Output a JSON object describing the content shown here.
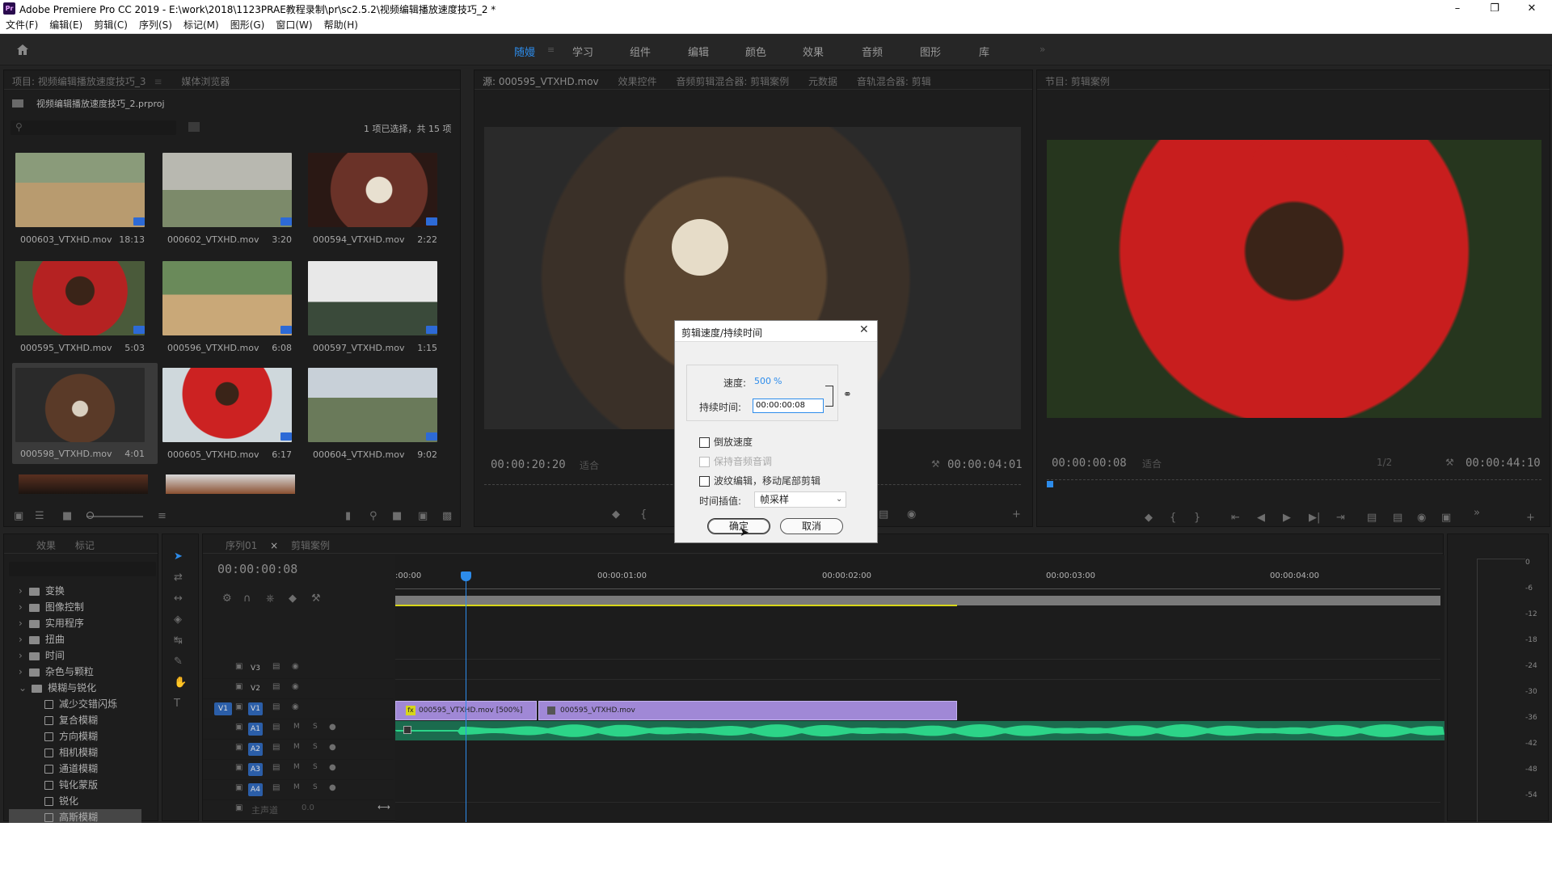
{
  "window": {
    "title": "Adobe Premiere Pro CC 2019 - E:\\work\\2018\\1123PRAE教程录制\\pr\\sc2.5.2\\视频编辑播放速度技巧_2 *",
    "icon": "Pr"
  },
  "menu": [
    "文件(F)",
    "编辑(E)",
    "剪辑(C)",
    "序列(S)",
    "标记(M)",
    "图形(G)",
    "窗口(W)",
    "帮助(H)"
  ],
  "workspaces": [
    {
      "label": "随嫚",
      "active": true
    },
    {
      "label": "学习"
    },
    {
      "label": "组件"
    },
    {
      "label": "编辑"
    },
    {
      "label": "颜色"
    },
    {
      "label": "效果"
    },
    {
      "label": "音频"
    },
    {
      "label": "图形"
    },
    {
      "label": "库"
    }
  ],
  "project": {
    "tabs": [
      "项目: 视频编辑播放速度技巧_3",
      "媒体浏览器"
    ],
    "file": "视频编辑播放速度技巧_2.prproj",
    "selection": "1 项已选择，共 15 项",
    "items": [
      {
        "name": "000603_VTXHD.mov",
        "dur": "18:13"
      },
      {
        "name": "000602_VTXHD.mov",
        "dur": "3:20"
      },
      {
        "name": "000594_VTXHD.mov",
        "dur": "2:22"
      },
      {
        "name": "000595_VTXHD.mov",
        "dur": "5:03"
      },
      {
        "name": "000596_VTXHD.mov",
        "dur": "6:08"
      },
      {
        "name": "000597_VTXHD.mov",
        "dur": "1:15"
      },
      {
        "name": "000598_VTXHD.mov",
        "dur": "4:01",
        "selected": true
      },
      {
        "name": "000605_VTXHD.mov",
        "dur": "6:17"
      },
      {
        "name": "000604_VTXHD.mov",
        "dur": "9:02"
      }
    ]
  },
  "source": {
    "tabs": [
      "源: 000595_VTXHD.mov",
      "效果控件",
      "音频剪辑混合器: 剪辑案例",
      "元数据",
      "音轨混合器: 剪辑"
    ],
    "tc_left": "00:00:20:20",
    "fit": "适合",
    "tc_right": "00:00:04:01"
  },
  "program": {
    "tabs": [
      "节目: 剪辑案例"
    ],
    "tc_left": "00:00:00:08",
    "fit": "适合",
    "quality": "1/2",
    "tc_right": "00:00:44:10"
  },
  "effects": {
    "tabs": [
      "效果",
      "标记"
    ],
    "tree": [
      {
        "label": "变换",
        "type": "folder"
      },
      {
        "label": "图像控制",
        "type": "folder"
      },
      {
        "label": "实用程序",
        "type": "folder"
      },
      {
        "label": "扭曲",
        "type": "folder"
      },
      {
        "label": "时间",
        "type": "folder"
      },
      {
        "label": "杂色与颗粒",
        "type": "folder"
      },
      {
        "label": "模糊与锐化",
        "type": "folder",
        "open": true
      },
      {
        "label": "减少交错闪烁",
        "type": "fx"
      },
      {
        "label": "复合模糊",
        "type": "fx"
      },
      {
        "label": "方向模糊",
        "type": "fx"
      },
      {
        "label": "相机模糊",
        "type": "fx"
      },
      {
        "label": "通道模糊",
        "type": "fx"
      },
      {
        "label": "钝化蒙版",
        "type": "fx"
      },
      {
        "label": "锐化",
        "type": "fx"
      },
      {
        "label": "高斯模糊",
        "type": "fx",
        "selected": true
      }
    ]
  },
  "timeline": {
    "tabs": [
      "序列01",
      "剪辑案例"
    ],
    "timecode": "00:00:00:08",
    "ruler": [
      ":00:00",
      "00:00:01:00",
      "00:00:02:00",
      "00:00:03:00",
      "00:00:04:00"
    ],
    "tracks": [
      "V3",
      "V2",
      "V1",
      "A1",
      "A2",
      "A3",
      "A4"
    ],
    "src_patch": [
      "V1",
      "A1"
    ],
    "master": "主声道",
    "master_val": "0.0",
    "clips": [
      "000595_VTXHD.mov [500%]",
      "000595_VTXHD.mov"
    ],
    "playhead_fraction": 0.067
  },
  "meter": {
    "scale": [
      "0",
      "-6",
      "-12",
      "-18",
      "-24",
      "-30",
      "-36",
      "-42",
      "-48",
      "-54"
    ]
  },
  "dialog": {
    "title": "剪辑速度/持续时间",
    "speed_label": "速度:",
    "speed_value": "500",
    "speed_unit": "%",
    "duration_label": "持续时间:",
    "duration_value": "00:00:00:08",
    "reverse": "倒放速度",
    "maintain_pitch": "保持音频音调",
    "ripple": "波纹编辑，移动尾部剪辑",
    "interp_label": "时间插值:",
    "interp_value": "帧采样",
    "ok": "确定",
    "cancel": "取消"
  },
  "colors": {
    "accent": "#2d8ceb",
    "clip": "#a088d6",
    "audio": "#2cd488",
    "work_area": "#d7d61a"
  }
}
